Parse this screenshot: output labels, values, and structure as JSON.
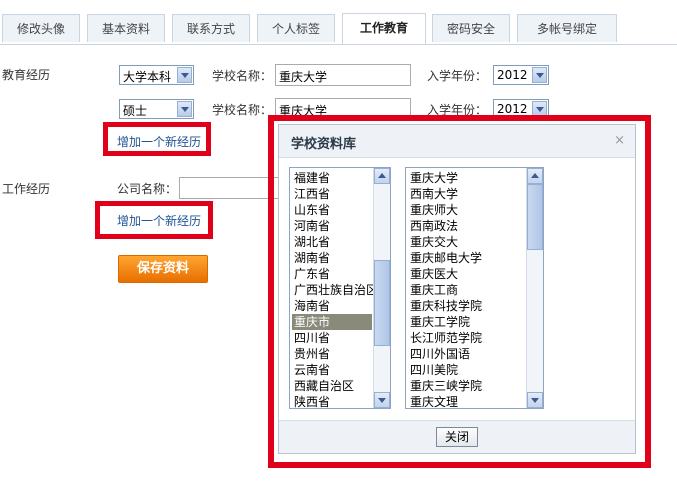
{
  "tabs": [
    "修改头像",
    "基本资料",
    "联系方式",
    "个人标签",
    "工作教育",
    "密码安全",
    "多帐号绑定"
  ],
  "education": {
    "section_label": "教育经历",
    "rows": [
      {
        "degree": "大学本科",
        "school_label": "学校名称：",
        "school": "重庆大学",
        "year_label": "入学年份：",
        "year": "2012"
      },
      {
        "degree": "硕士",
        "school_label": "学校名称：",
        "school": "重庆大学",
        "year_label": "入学年份：",
        "year": "2012"
      }
    ],
    "add_link": "增加一个新经历"
  },
  "work": {
    "section_label": "工作经历",
    "company_label": "公司名称：",
    "company_value": "",
    "add_link": "增加一个新经历"
  },
  "save_label": "保存资料",
  "dialog": {
    "title": "学校资料库",
    "close_symbol": "×",
    "provinces": [
      "福建省",
      "江西省",
      "山东省",
      "河南省",
      "湖北省",
      "湖南省",
      "广东省",
      "广西壮族自治区",
      "海南省",
      "重庆市",
      "四川省",
      "贵州省",
      "云南省",
      "西藏自治区",
      "陕西省"
    ],
    "selected_province": "重庆市",
    "schools": [
      "重庆大学",
      "西南大学",
      "重庆师大",
      "西南政法",
      "重庆交大",
      "重庆邮电大学",
      "重庆医大",
      "重庆工商",
      "重庆科技学院",
      "重庆工学院",
      "长江师范学院",
      "四川外国语",
      "四川美院",
      "重庆三峡学院",
      "重庆文理"
    ],
    "close_button": "关闭"
  },
  "colors": {
    "highlight_border": "#e0001a",
    "save_button": "#f18a10",
    "link": "#1e5494",
    "selected_item": "#8a8a7a"
  }
}
